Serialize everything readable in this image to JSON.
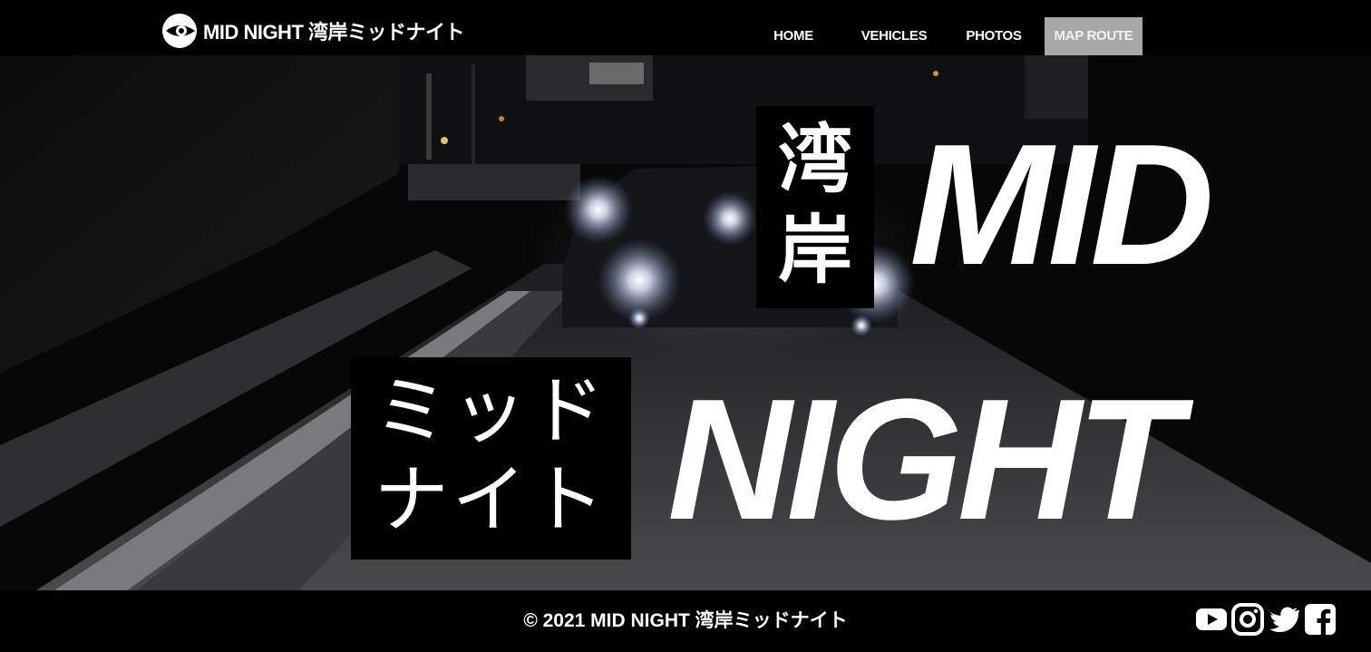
{
  "header": {
    "logo_text": "MID NIGHT  湾岸ミッドナイト",
    "nav": [
      {
        "label": "HOME",
        "active": false
      },
      {
        "label": "VEHICLES",
        "active": false
      },
      {
        "label": "PHOTOS",
        "active": false
      },
      {
        "label": "MAP ROUTE",
        "active": true
      }
    ]
  },
  "hero": {
    "kanji_line1": "湾",
    "kanji_line2": "岸",
    "katakana_line1": "ミッド",
    "katakana_line2": "ナイト",
    "title_line1": "MID",
    "title_line2": "NIGHT"
  },
  "footer": {
    "copyright": "© 2021 MID NIGHT 湾岸ミッドナイト",
    "social": [
      "youtube-icon",
      "instagram-icon",
      "twitter-icon",
      "facebook-icon"
    ]
  },
  "colors": {
    "background": "#000000",
    "text": "#ffffff",
    "nav_active_bg": "#a8a8a8"
  }
}
